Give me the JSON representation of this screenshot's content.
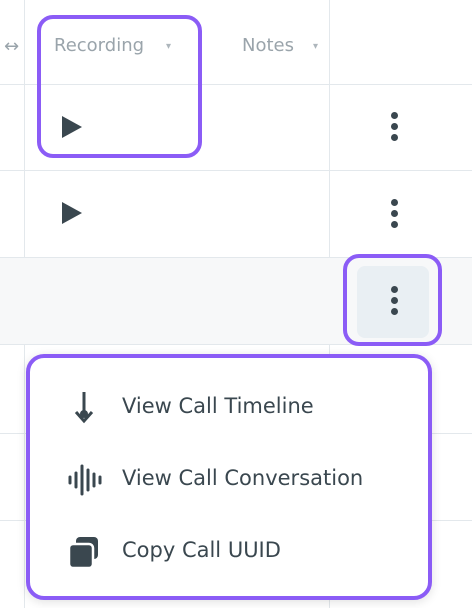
{
  "header": {
    "recording_label": "Recording",
    "notes_label": "Notes",
    "resize_icon": "↔",
    "caret": "▾"
  },
  "rows": [
    {
      "has_recording": true
    },
    {
      "has_recording": true
    },
    {
      "has_recording": false
    }
  ],
  "menu": {
    "items": [
      {
        "label": "View Call Timeline",
        "icon": "timeline-icon"
      },
      {
        "label": "View Call Conversation",
        "icon": "waveform-icon"
      },
      {
        "label": "Copy Call UUID",
        "icon": "copy-icon"
      }
    ]
  },
  "colors": {
    "highlight": "#8b5cf6",
    "icon": "#3a474f",
    "muted_text": "#9aa4ab"
  }
}
